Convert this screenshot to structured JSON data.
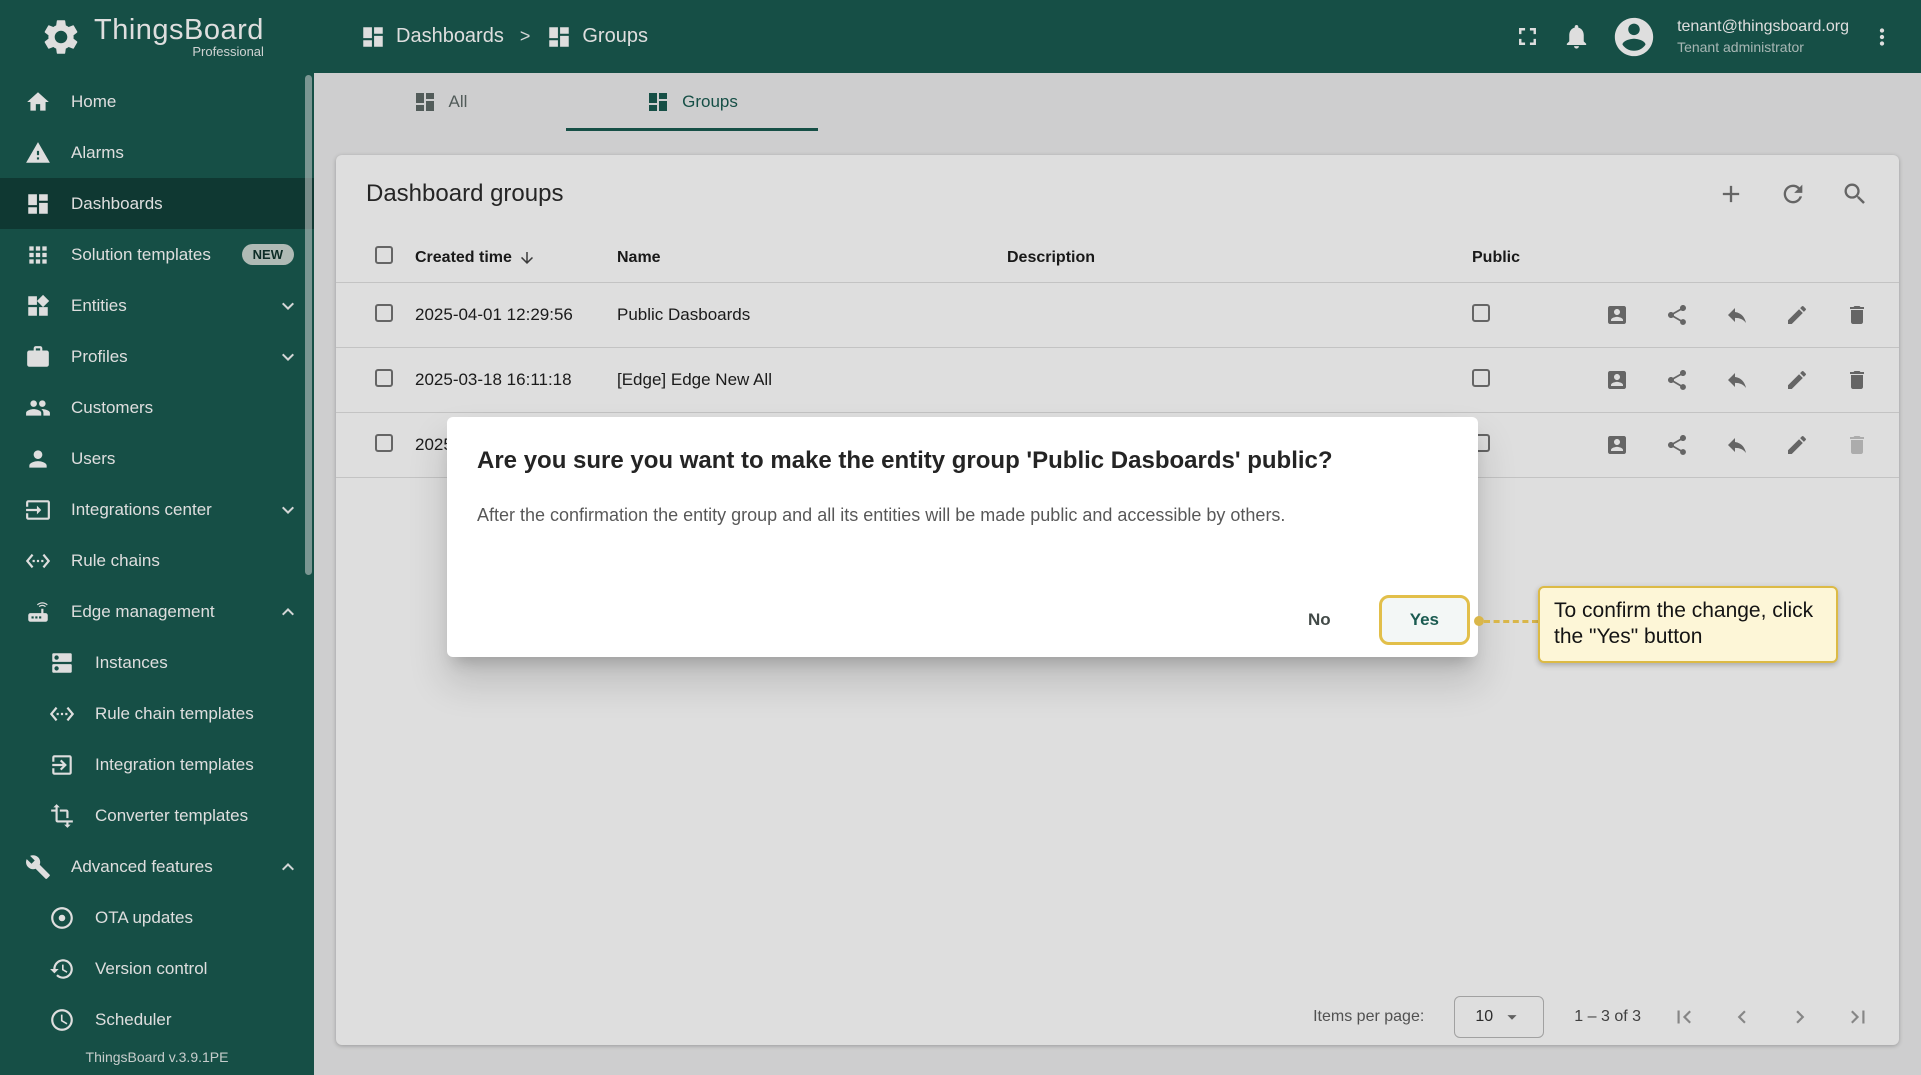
{
  "colors": {
    "primary": "#1a5b51",
    "highlight_border": "#e2bf4a",
    "highlight_bg": "#fdf6d7"
  },
  "header": {
    "logo_title": "ThingsBoard",
    "logo_subtitle": "Professional",
    "logo_icon": "logo-gear",
    "breadcrumb_sep": ">",
    "breadcrumb": [
      {
        "label": "Dashboards",
        "icon": "dashboards"
      },
      {
        "label": "Groups",
        "icon": "dashboards"
      }
    ],
    "icons": {
      "fullscreen": "fullscreen",
      "notifications": "bell",
      "account": "account",
      "menu": "more-vert"
    },
    "user_email": "tenant@thingsboard.org",
    "user_role": "Tenant administrator"
  },
  "sidebar": {
    "items": [
      {
        "label": "Home",
        "icon": "home"
      },
      {
        "label": "Alarms",
        "icon": "warning"
      },
      {
        "label": "Dashboards",
        "icon": "dashboards"
      },
      {
        "label": "Solution templates",
        "icon": "apps",
        "badge": "NEW"
      },
      {
        "label": "Entities",
        "icon": "entities",
        "chevron": "chevron-down"
      },
      {
        "label": "Profiles",
        "icon": "briefcase",
        "chevron": "chevron-down"
      },
      {
        "label": "Customers",
        "icon": "people"
      },
      {
        "label": "Users",
        "icon": "person"
      },
      {
        "label": "Integrations center",
        "icon": "integration",
        "chevron": "chevron-down"
      },
      {
        "label": "Rule chains",
        "icon": "rule-chain"
      },
      {
        "label": "Edge management",
        "icon": "router",
        "chevron": "chevron-up"
      },
      {
        "label": "Instances",
        "icon": "instances"
      },
      {
        "label": "Rule chain templates",
        "icon": "rule-chain"
      },
      {
        "label": "Integration templates",
        "icon": "integration-template"
      },
      {
        "label": "Converter templates",
        "icon": "transform"
      },
      {
        "label": "Advanced features",
        "icon": "wrench",
        "chevron": "chevron-up"
      },
      {
        "label": "OTA updates",
        "icon": "target"
      },
      {
        "label": "Version control",
        "icon": "history"
      },
      {
        "label": "Scheduler",
        "icon": "clock"
      }
    ],
    "version": "ThingsBoard v.3.9.1PE"
  },
  "tabs": [
    {
      "label": "All",
      "icon": "dashboards"
    },
    {
      "label": "Groups",
      "icon": "dashboards"
    }
  ],
  "card": {
    "title": "Dashboard groups",
    "icons": {
      "add": "plus",
      "refresh": "refresh",
      "search": "search",
      "sort": "arrow-down"
    },
    "columns": {
      "created": "Created time",
      "name": "Name",
      "description": "Description",
      "public": "Public"
    },
    "row_icons": {
      "assign": "contacts",
      "share": "share",
      "undo": "undo",
      "edit": "edit",
      "delete": "delete"
    },
    "rows": [
      {
        "created": "2025-04-01 12:29:56",
        "name": "Public Dasboards",
        "description": ""
      },
      {
        "created": "2025-03-18 16:11:18",
        "name": "[Edge] Edge New All",
        "description": ""
      },
      {
        "created": "2025",
        "name": "",
        "description": ""
      }
    ]
  },
  "pagination": {
    "label": "Items per page:",
    "page_size": "10",
    "range": "1 – 3 of 3",
    "icons": {
      "caret": "caret-down",
      "first": "first-page",
      "prev": "chevron-left",
      "next": "chevron-right",
      "last": "last-page"
    }
  },
  "dialog": {
    "title": "Are you sure you want to make the entity group 'Public Dasboards' public?",
    "message": "After the confirmation the entity group and all its entities will be made public and accessible by others.",
    "buttons": {
      "no": "No",
      "yes": "Yes"
    }
  },
  "callout": {
    "text": "To confirm the change, click the \"Yes\" button"
  }
}
